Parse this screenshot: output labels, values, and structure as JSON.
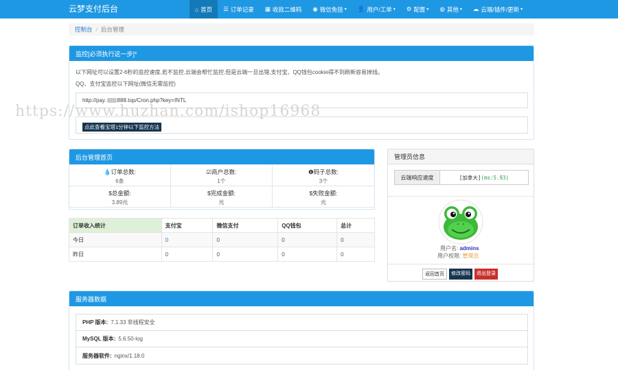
{
  "nav": {
    "brand": "云梦支付后台",
    "items": [
      {
        "icon": "home-icon",
        "glyph": "⌂",
        "label": "首页",
        "caret": ""
      },
      {
        "icon": "list-icon",
        "glyph": "☰",
        "label": "订单记录",
        "caret": ""
      },
      {
        "icon": "qrcode-icon",
        "glyph": "▦",
        "label": "收款二维码",
        "caret": ""
      },
      {
        "icon": "wechat-icon",
        "glyph": "◉",
        "label": "微信免挂",
        "caret": "▾"
      },
      {
        "icon": "user-icon",
        "glyph": "👤",
        "label": "用户/工单",
        "caret": "▾"
      },
      {
        "icon": "gear-icon",
        "glyph": "⚙",
        "label": "配置",
        "caret": "▾"
      },
      {
        "icon": "globe-icon",
        "glyph": "◍",
        "label": "其他",
        "caret": "▾"
      },
      {
        "icon": "cloud-icon",
        "glyph": "☁",
        "label": "云端/插件/更新",
        "caret": "▾"
      }
    ]
  },
  "breadcrumb": {
    "home": "控制台",
    "sep": "/",
    "current": "后台管理"
  },
  "monitor": {
    "title": "监控[必须执行这一步]*",
    "desc": "以下网址可以设置2-6秒的监控速度,若不监控,云端会帮忙监控,但是云端一旦出错,支付宝、QQ钱包cookie得不到刷新容易掉线。",
    "desc2": "QQ、支付宝监控以下网址(微信无需监控)",
    "url_prefix": "http://pay.",
    "url_suffix": "888.top/Cron.php?key=INTL",
    "button": "点此查看宝塔1分钟以下监控方法"
  },
  "watermark": "https://www.huzhan.com/ishop16968",
  "admin_home": {
    "title": "后台管理首页",
    "stats": [
      {
        "icon": "drop-icon",
        "glyph": "💧",
        "label": "订单总数:",
        "value": "6条"
      },
      {
        "icon": "check-icon",
        "glyph": "☑",
        "label": "商户总数:",
        "value": "1个"
      },
      {
        "icon": "info-icon",
        "glyph": "❶",
        "label": "码子总数:",
        "value": "3个"
      },
      {
        "icon": "dollar-icon",
        "glyph": "$",
        "label": "总金额:",
        "value": "3.89元"
      },
      {
        "icon": "dollar-icon",
        "glyph": "$",
        "label": "完成金额:",
        "value": "元"
      },
      {
        "icon": "dollar-icon",
        "glyph": "$",
        "label": "失败金额:",
        "value": "元"
      }
    ]
  },
  "income": {
    "headers": [
      "订单收入统计",
      "支付宝",
      "微信支付",
      "QQ钱包",
      "总计"
    ],
    "rows": [
      [
        "今日",
        "0",
        "0",
        "0",
        "0"
      ],
      [
        "昨日",
        "0",
        "0",
        "0",
        "0"
      ]
    ]
  },
  "admin_info": {
    "title": "管理员信息",
    "speed_label": "云端响应速度",
    "speed_location": "[加拿大]",
    "speed_ms": "(ms:5.93)",
    "username_label": "用户名:",
    "username": "admins",
    "role_label": "用户权限:",
    "role": "管理员",
    "buttons": {
      "home": "返回首页",
      "password": "修改密码",
      "logout": "退出登录"
    }
  },
  "server": {
    "title": "服务器数据",
    "items": [
      {
        "key": "PHP 版本:",
        "value": "7.1.33 非线程安全"
      },
      {
        "key": "MySQL 版本:",
        "value": "5.6.50-log"
      },
      {
        "key": "服务器软件:",
        "value": "nginx/1.18.0"
      }
    ]
  },
  "colors": {
    "primary": "#1f98e3",
    "active": "#1479b8",
    "dark_button": "#16354f",
    "danger": "#c9302c"
  }
}
